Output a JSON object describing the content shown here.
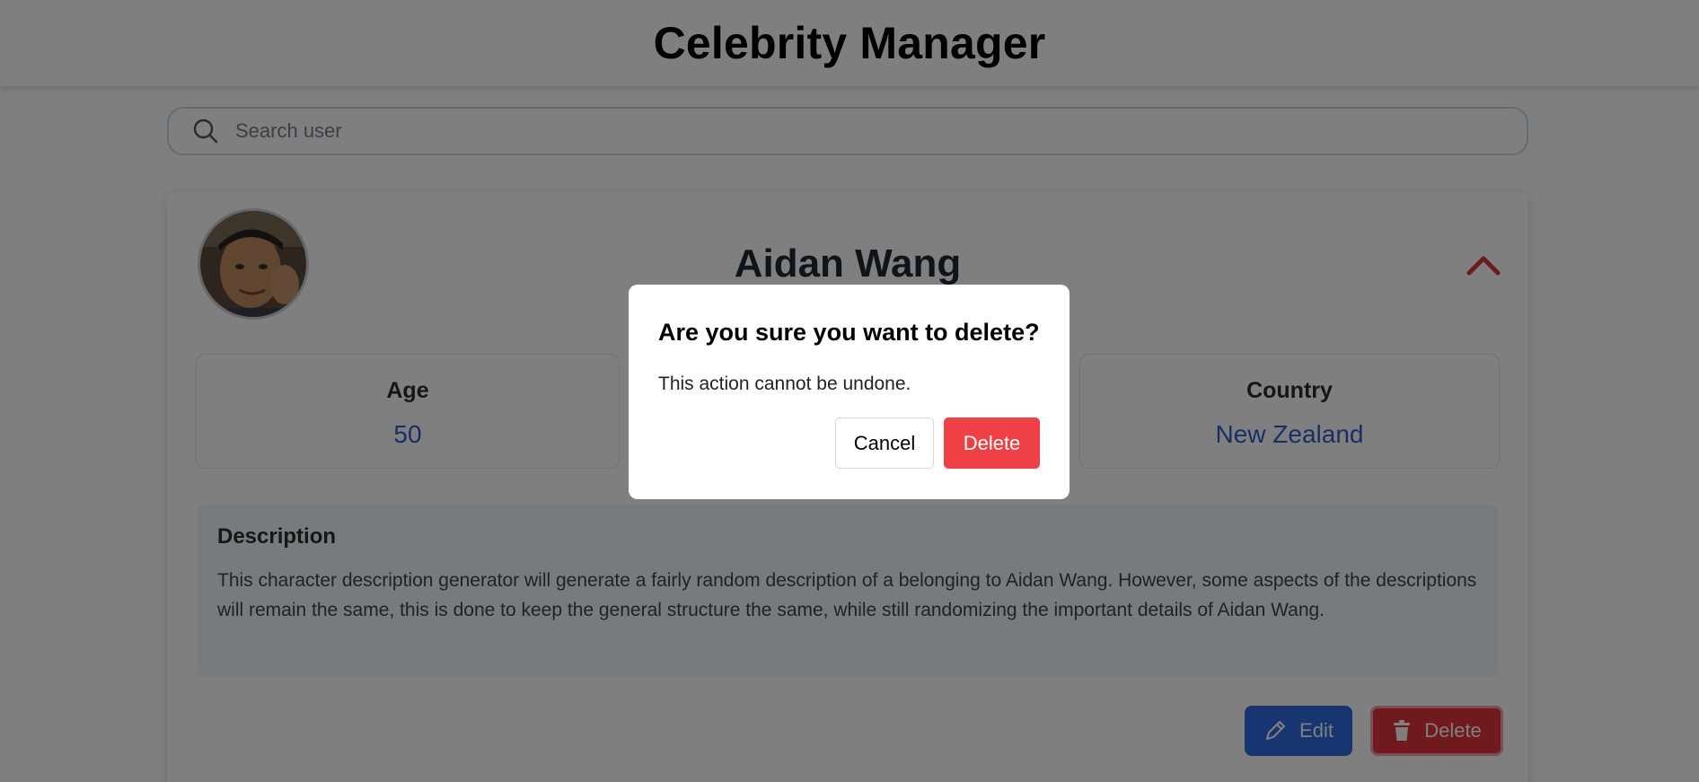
{
  "app": {
    "title": "Celebrity Manager"
  },
  "search": {
    "placeholder": "Search user",
    "value": ""
  },
  "celebrity": {
    "name": "Aidan Wang",
    "stats": [
      {
        "label": "Age",
        "value": "50"
      },
      {
        "label": "Country",
        "value": "New Zealand"
      }
    ],
    "description_heading": "Description",
    "description": "This character description generator will generate a fairly random description of a belonging to Aidan Wang. However, some aspects of the descriptions will remain the same, this is done to keep the general structure the same, while still randomizing the important details of Aidan Wang."
  },
  "card_actions": {
    "edit_label": "Edit",
    "delete_label": "Delete"
  },
  "dialog": {
    "title": "Are you sure you want to delete?",
    "message": "This action cannot be undone.",
    "cancel_label": "Cancel",
    "confirm_label": "Delete"
  },
  "icons": {
    "search": "search-icon",
    "collapse": "chevron-up-icon",
    "edit": "pencil-icon",
    "delete": "trash-icon"
  },
  "colors": {
    "accent_blue": "#2d6ae3",
    "danger_red": "#e0353c",
    "value_blue": "#2f5fc9",
    "overlay": "rgba(0,0,0,0.5)"
  }
}
